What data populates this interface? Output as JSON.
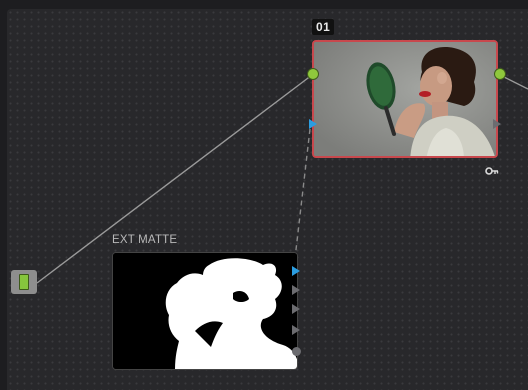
{
  "node_editor": {
    "nodes": [
      {
        "id": "main-node",
        "number": "01",
        "selected": true
      },
      {
        "id": "matte-node",
        "label": "EXT MATTE"
      }
    ]
  },
  "colors": {
    "selected_border": "#c8484d",
    "rgb_port": "#8fc83c",
    "key_port": "#2b9de0",
    "wire": "#9a9a9a",
    "canvas": "#28282b"
  },
  "icons": [
    "key-icon"
  ]
}
